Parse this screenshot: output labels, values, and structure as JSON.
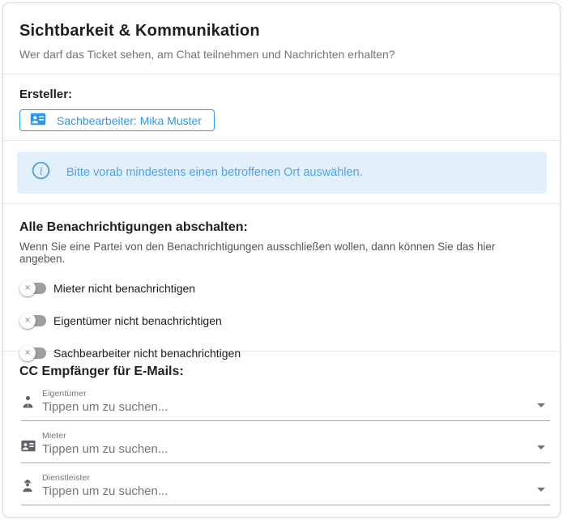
{
  "header": {
    "title": "Sichtbarkeit & Kommunikation",
    "subtitle": "Wer darf das Ticket sehen, am Chat teilnehmen und Nachrichten erhalten?"
  },
  "ersteller": {
    "label": "Ersteller:",
    "button_label": "Sachbearbeiter: Mika Muster",
    "button_icon": "id-card-icon"
  },
  "info_banner": {
    "icon": "info-icon",
    "text": "Bitte vorab mindestens einen betroffenen Ort auswählen."
  },
  "notifications": {
    "title": "Alle Benachrichtigungen abschalten:",
    "subtitle": "Wenn Sie eine Partei von den Benachrichtigungen ausschließen wollen, dann können Sie das hier angeben.",
    "toggles": [
      {
        "label": "Mieter nicht benachrichtigen",
        "state": "off"
      },
      {
        "label": "Eigentümer nicht benachrichtigen",
        "state": "off"
      },
      {
        "label": "Sachbearbeiter nicht benachrichtigen",
        "state": "off"
      }
    ]
  },
  "cc_recipients": {
    "title": "CC Empfänger für E-Mails:",
    "fields": [
      {
        "label": "Eigentümer",
        "placeholder": "Tippen um zu suchen...",
        "icon": "person-icon"
      },
      {
        "label": "Mieter",
        "placeholder": "Tippen um zu suchen...",
        "icon": "id-card-icon"
      },
      {
        "label": "Dienstleister",
        "placeholder": "Tippen um zu suchen...",
        "icon": "worker-icon"
      }
    ]
  },
  "ui": {
    "toggle_off_glyph": "×",
    "info_glyph": "i"
  },
  "colors": {
    "accent_blue": "#2b97f1",
    "banner_bg": "#e3f0fb",
    "banner_text": "#4da3ef",
    "toggle_track": "#9e9e9e",
    "icon_gray": "#5f6368",
    "divider": "#e6e6e6"
  }
}
